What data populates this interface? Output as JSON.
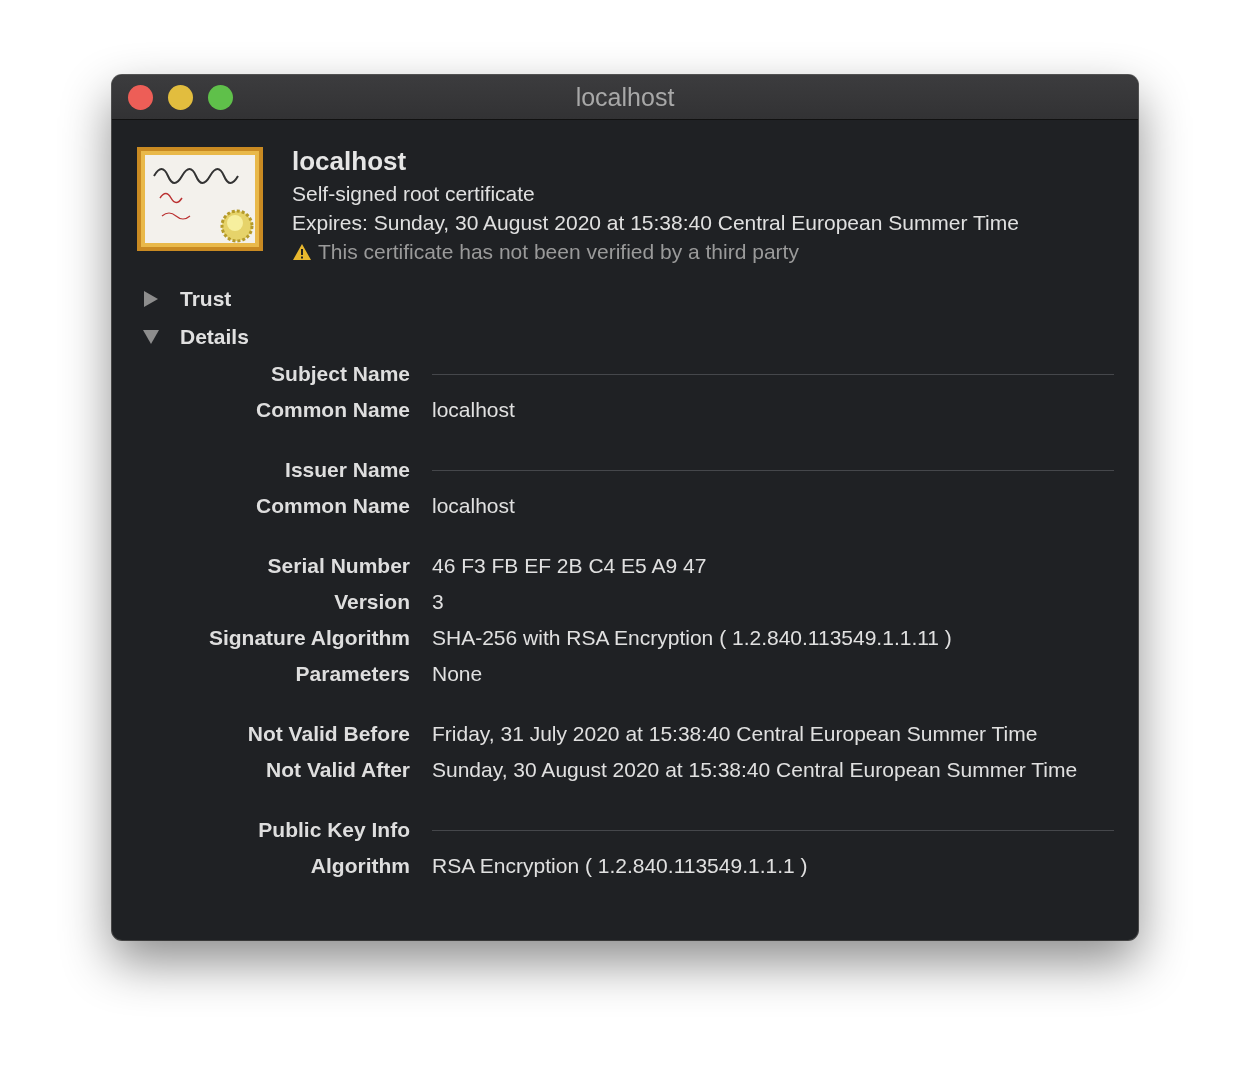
{
  "window": {
    "title": "localhost"
  },
  "header": {
    "name": "localhost",
    "subtitle": "Self-signed root certificate",
    "expires": "Expires: Sunday, 30 August 2020 at 15:38:40 Central European Summer Time",
    "warning": "This certificate has not been verified by a third party"
  },
  "disclosures": [
    {
      "label": "Trust",
      "expanded": false
    },
    {
      "label": "Details",
      "expanded": true
    }
  ],
  "details": [
    {
      "rows": [
        {
          "kind": "section",
          "label": "Subject Name"
        },
        {
          "kind": "field",
          "label": "Common Name",
          "value": "localhost"
        }
      ]
    },
    {
      "rows": [
        {
          "kind": "section",
          "label": "Issuer Name"
        },
        {
          "kind": "field",
          "label": "Common Name",
          "value": "localhost"
        }
      ]
    },
    {
      "rows": [
        {
          "kind": "field",
          "label": "Serial Number",
          "value": "46 F3 FB EF 2B C4 E5 A9 47"
        },
        {
          "kind": "field",
          "label": "Version",
          "value": "3"
        },
        {
          "kind": "field",
          "label": "Signature Algorithm",
          "value": "SHA-256 with RSA Encryption ( 1.2.840.113549.1.1.11 )"
        },
        {
          "kind": "field",
          "label": "Parameters",
          "value": "None"
        }
      ]
    },
    {
      "rows": [
        {
          "kind": "field",
          "label": "Not Valid Before",
          "value": "Friday, 31 July 2020 at 15:38:40 Central European Summer Time"
        },
        {
          "kind": "field",
          "label": "Not Valid After",
          "value": "Sunday, 30 August 2020 at 15:38:40 Central European Summer Time"
        }
      ]
    },
    {
      "rows": [
        {
          "kind": "section",
          "label": "Public Key Info"
        },
        {
          "kind": "field",
          "label": "Algorithm",
          "value": "RSA Encryption ( 1.2.840.113549.1.1.1 )"
        }
      ]
    }
  ]
}
